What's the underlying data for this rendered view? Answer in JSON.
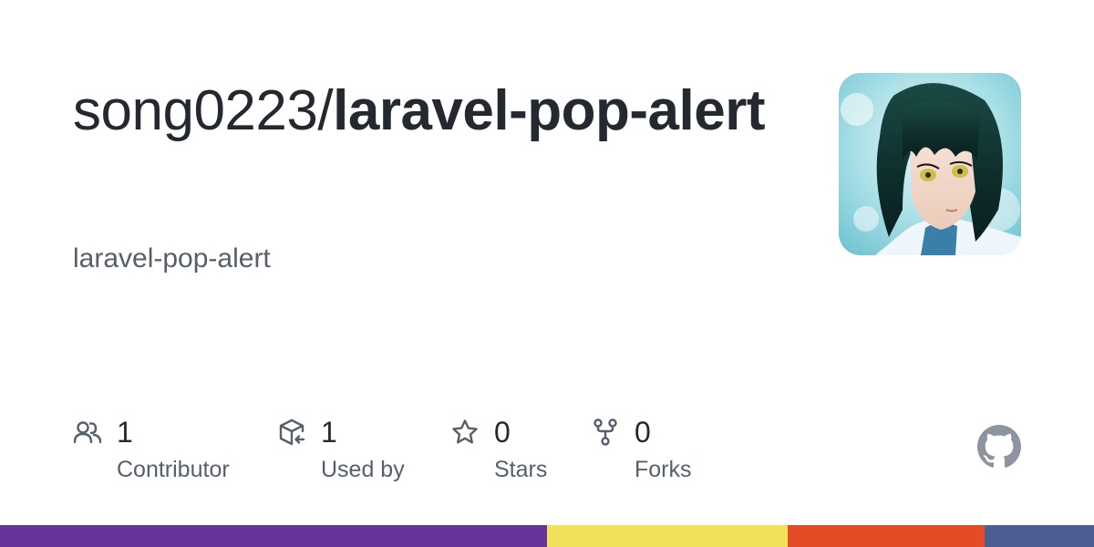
{
  "repo": {
    "owner": "song0223/",
    "name": "laravel-pop-alert",
    "description": "laravel-pop-alert"
  },
  "avatar": {
    "icon": "anime-avatar-image"
  },
  "stats": [
    {
      "icon": "people-icon",
      "value": "1",
      "label": "Contributor"
    },
    {
      "icon": "package-dependents-icon",
      "value": "1",
      "label": "Used by"
    },
    {
      "icon": "star-icon",
      "value": "0",
      "label": "Stars"
    },
    {
      "icon": "repo-forked-icon",
      "value": "0",
      "label": "Forks"
    }
  ],
  "brand": {
    "icon": "github-mark-icon",
    "color": "#8c959f"
  },
  "colors": {
    "text": "#24292f",
    "muted": "#57606a",
    "icon": "#57606a"
  },
  "languages": [
    {
      "color": "#663399",
      "fraction": 0.5
    },
    {
      "color": "#f1e05a",
      "fraction": 0.22
    },
    {
      "color": "#e34c26",
      "fraction": 0.18
    },
    {
      "color": "#4f5d95",
      "fraction": 0.1
    }
  ]
}
